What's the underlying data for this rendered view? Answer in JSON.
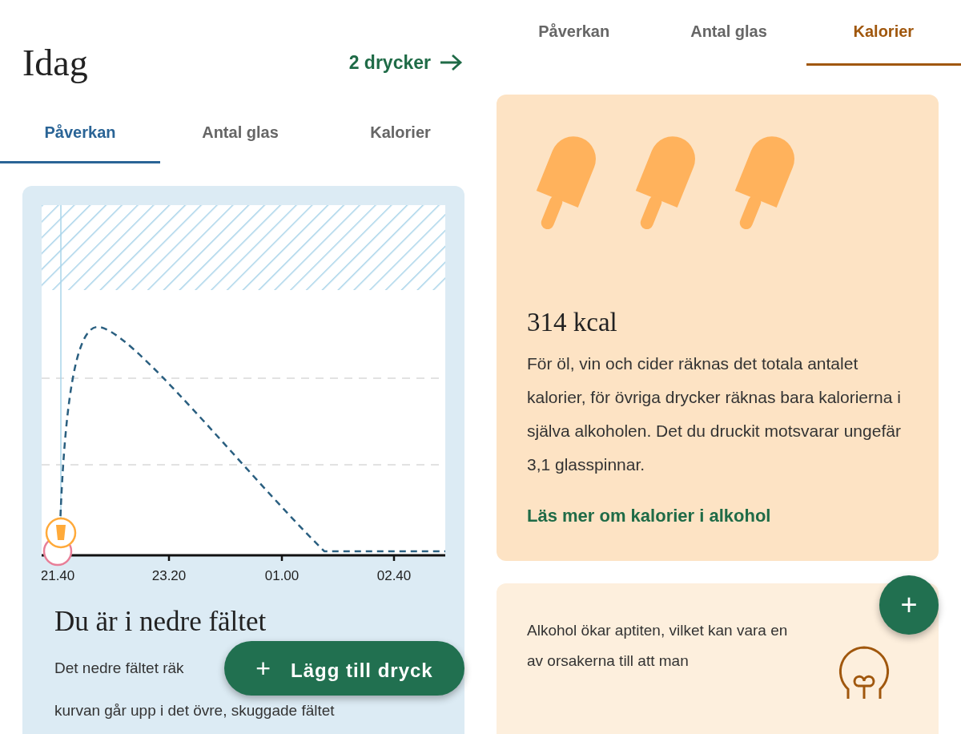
{
  "left_screen": {
    "title": "Idag",
    "drinks_link": "2 drycker",
    "tabs": [
      {
        "label": "Påverkan",
        "selected": true
      },
      {
        "label": "Antal glas",
        "selected": false
      },
      {
        "label": "Kalorier",
        "selected": false
      }
    ],
    "chart": {
      "x_labels": [
        "21.40",
        "23.20",
        "01.00",
        "02.40"
      ]
    },
    "status": {
      "heading": "Du är i nedre fältet",
      "lines": [
        "Det nedre fältet räk",
        "kurvan går upp i det övre, skuggade fältet"
      ]
    },
    "add_button": {
      "icon": "+",
      "label": "Lägg till dryck"
    }
  },
  "right_screen": {
    "tabs": [
      {
        "label": "Påverkan",
        "selected": false
      },
      {
        "label": "Antal glas",
        "selected": false
      },
      {
        "label": "Kalorier",
        "selected": true
      }
    ],
    "calorie_card": {
      "amount": "314 kcal",
      "text": "För öl, vin och cider räknas det totala antalet kalorier, för övriga drycker räknas bara kalorierna i själva alkoholen. Det du druckit motsvarar ungefär 3,1 glasspinnar.",
      "link": "Läs mer om kalorier i alkohol"
    },
    "tip_card": {
      "text": "Alkohol ökar aptiten, vilket kan vara en av orsakerna till att man"
    },
    "fab": {
      "icon": "+"
    }
  }
}
